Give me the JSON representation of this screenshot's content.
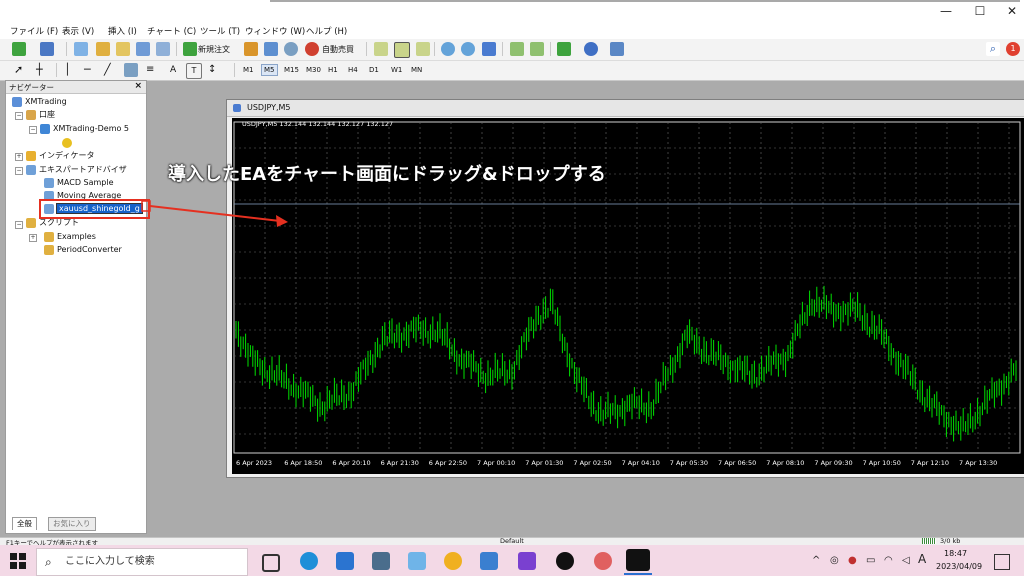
{
  "menu": [
    "ファイル (F)",
    "表示 (V)",
    "挿入 (I)",
    "チャート (C)",
    "ツール (T)",
    "ウィンドウ (W)",
    "ヘルプ (H)"
  ],
  "toolbar": {
    "new_order": "新規注文",
    "auto_trade": "自動売買",
    "timeframes": [
      "M1",
      "M5",
      "M15",
      "M30",
      "H1",
      "H4",
      "D1",
      "W1",
      "MN"
    ],
    "active_timeframe": "M5",
    "text_tool": "A",
    "badge": "1"
  },
  "navigator": {
    "title": "ナビゲーター",
    "close": "×",
    "root": "XMTrading",
    "accounts": "口座",
    "account_name": "XMTrading-Demo 5",
    "indicators": "インディケータ",
    "expert_advisors": "エキスパートアドバイザ",
    "ea_items": [
      "MACD Sample",
      "Moving Average",
      "xauusd_shinegold_g"
    ],
    "scripts": "スクリプト",
    "script_items": [
      "Examples",
      "PeriodConverter"
    ],
    "tabs": [
      "全般",
      "お気に入り"
    ]
  },
  "chart": {
    "window_title": "USDJPY,M5",
    "info_line": "USDJPY,M5  132.144 132.144 132.127 132.127",
    "time_labels": [
      "6 Apr 2023",
      "6 Apr 18:50",
      "6 Apr 20:10",
      "6 Apr 21:30",
      "6 Apr 22:50",
      "7 Apr 00:10",
      "7 Apr 01:30",
      "7 Apr 02:50",
      "7 Apr 04:10",
      "7 Apr 05:30",
      "7 Apr 06:50",
      "7 Apr 08:10",
      "7 Apr 09:30",
      "7 Apr 10:50",
      "7 Apr 12:10",
      "7 Apr 13:30"
    ],
    "candle_color": "#00e000"
  },
  "annotation": "導入したEAをチャート画面にドラッグ&ドロップする",
  "status": {
    "help": "F1キーでヘルプが表示されます",
    "profile": "Default",
    "traffic": "3/0 kb"
  },
  "taskbar": {
    "search_placeholder": "ここに入力して検索",
    "time": "18:47",
    "date": "2023/04/09",
    "ime": "A"
  }
}
